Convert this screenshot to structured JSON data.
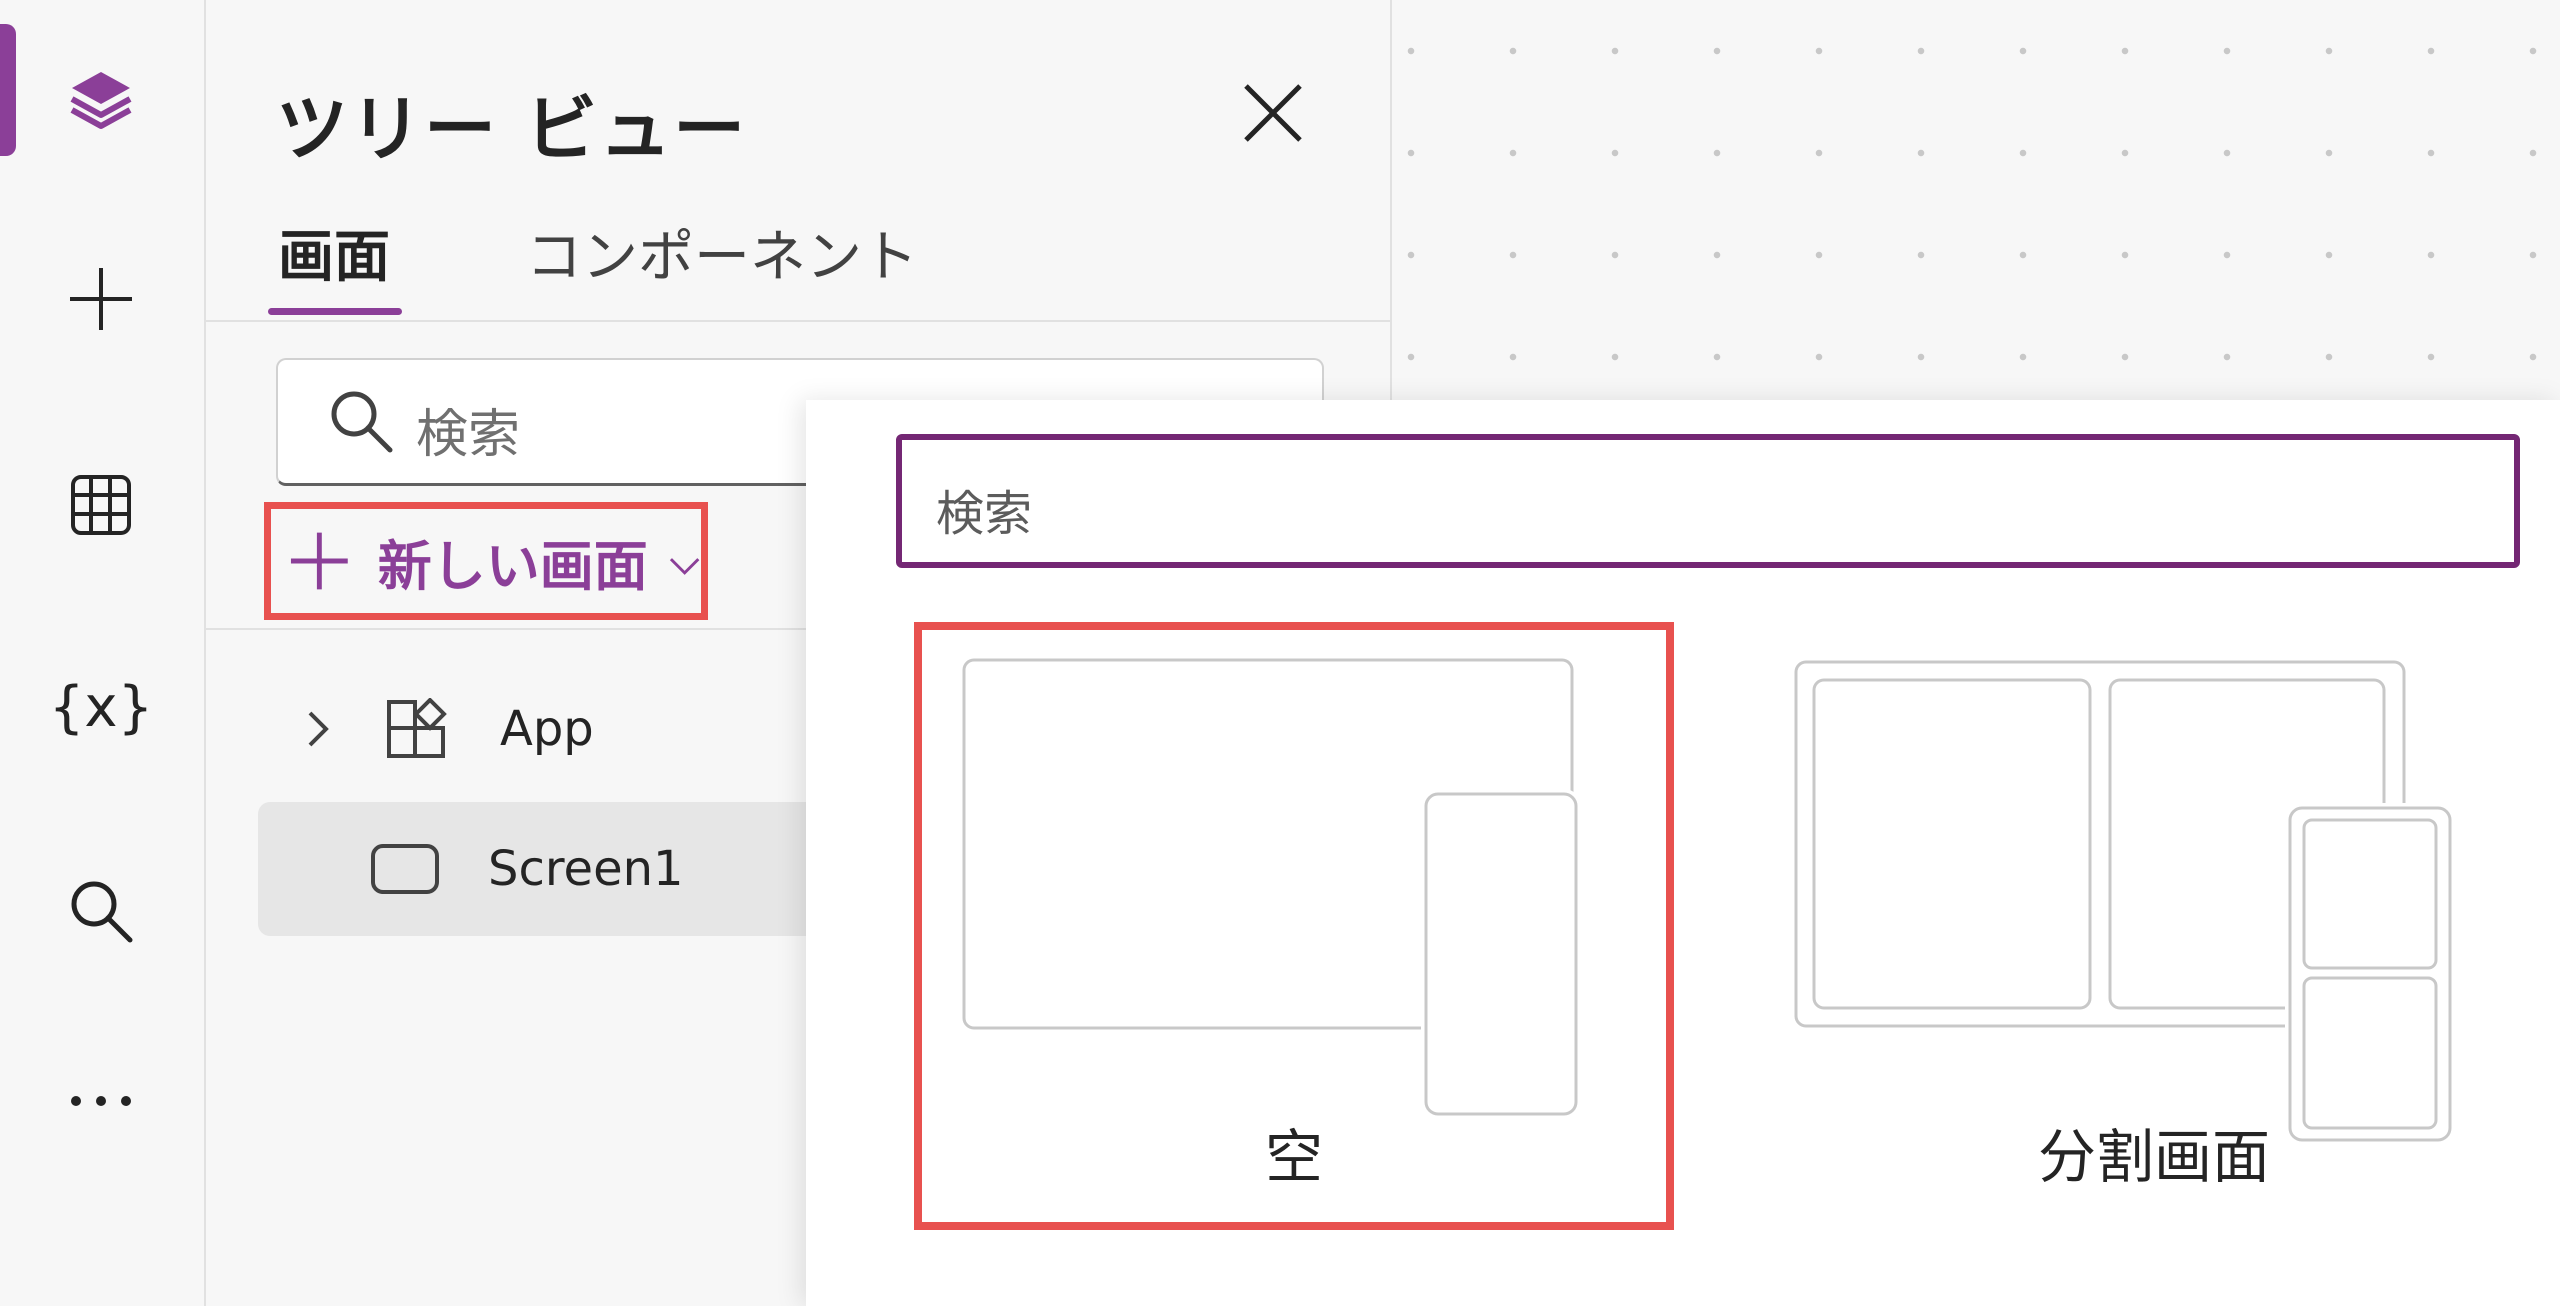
{
  "tree_view": {
    "title": "ツリー ビュー",
    "tabs": [
      {
        "label": "画面",
        "selected": true
      },
      {
        "label": "コンポーネント",
        "selected": false
      }
    ],
    "search": {
      "placeholder": "検索"
    },
    "new_screen_label": "新しい画面",
    "items": [
      {
        "label": "App",
        "expandable": true
      },
      {
        "label": "Screen1",
        "selected": true
      }
    ]
  },
  "rail": {
    "items": [
      "layers-icon",
      "add-icon",
      "data-table-icon",
      "variables-icon",
      "search-icon",
      "more-icon"
    ],
    "active": "layers-icon",
    "variables_glyph": "{x}"
  },
  "flyout": {
    "search": {
      "placeholder": "検索"
    },
    "layouts": [
      {
        "label": "空"
      },
      {
        "label": "分割画面"
      }
    ]
  },
  "colors": {
    "accent": "#8b3f98",
    "highlight_outline": "#e8514f",
    "flyout_search_border": "#742774"
  }
}
